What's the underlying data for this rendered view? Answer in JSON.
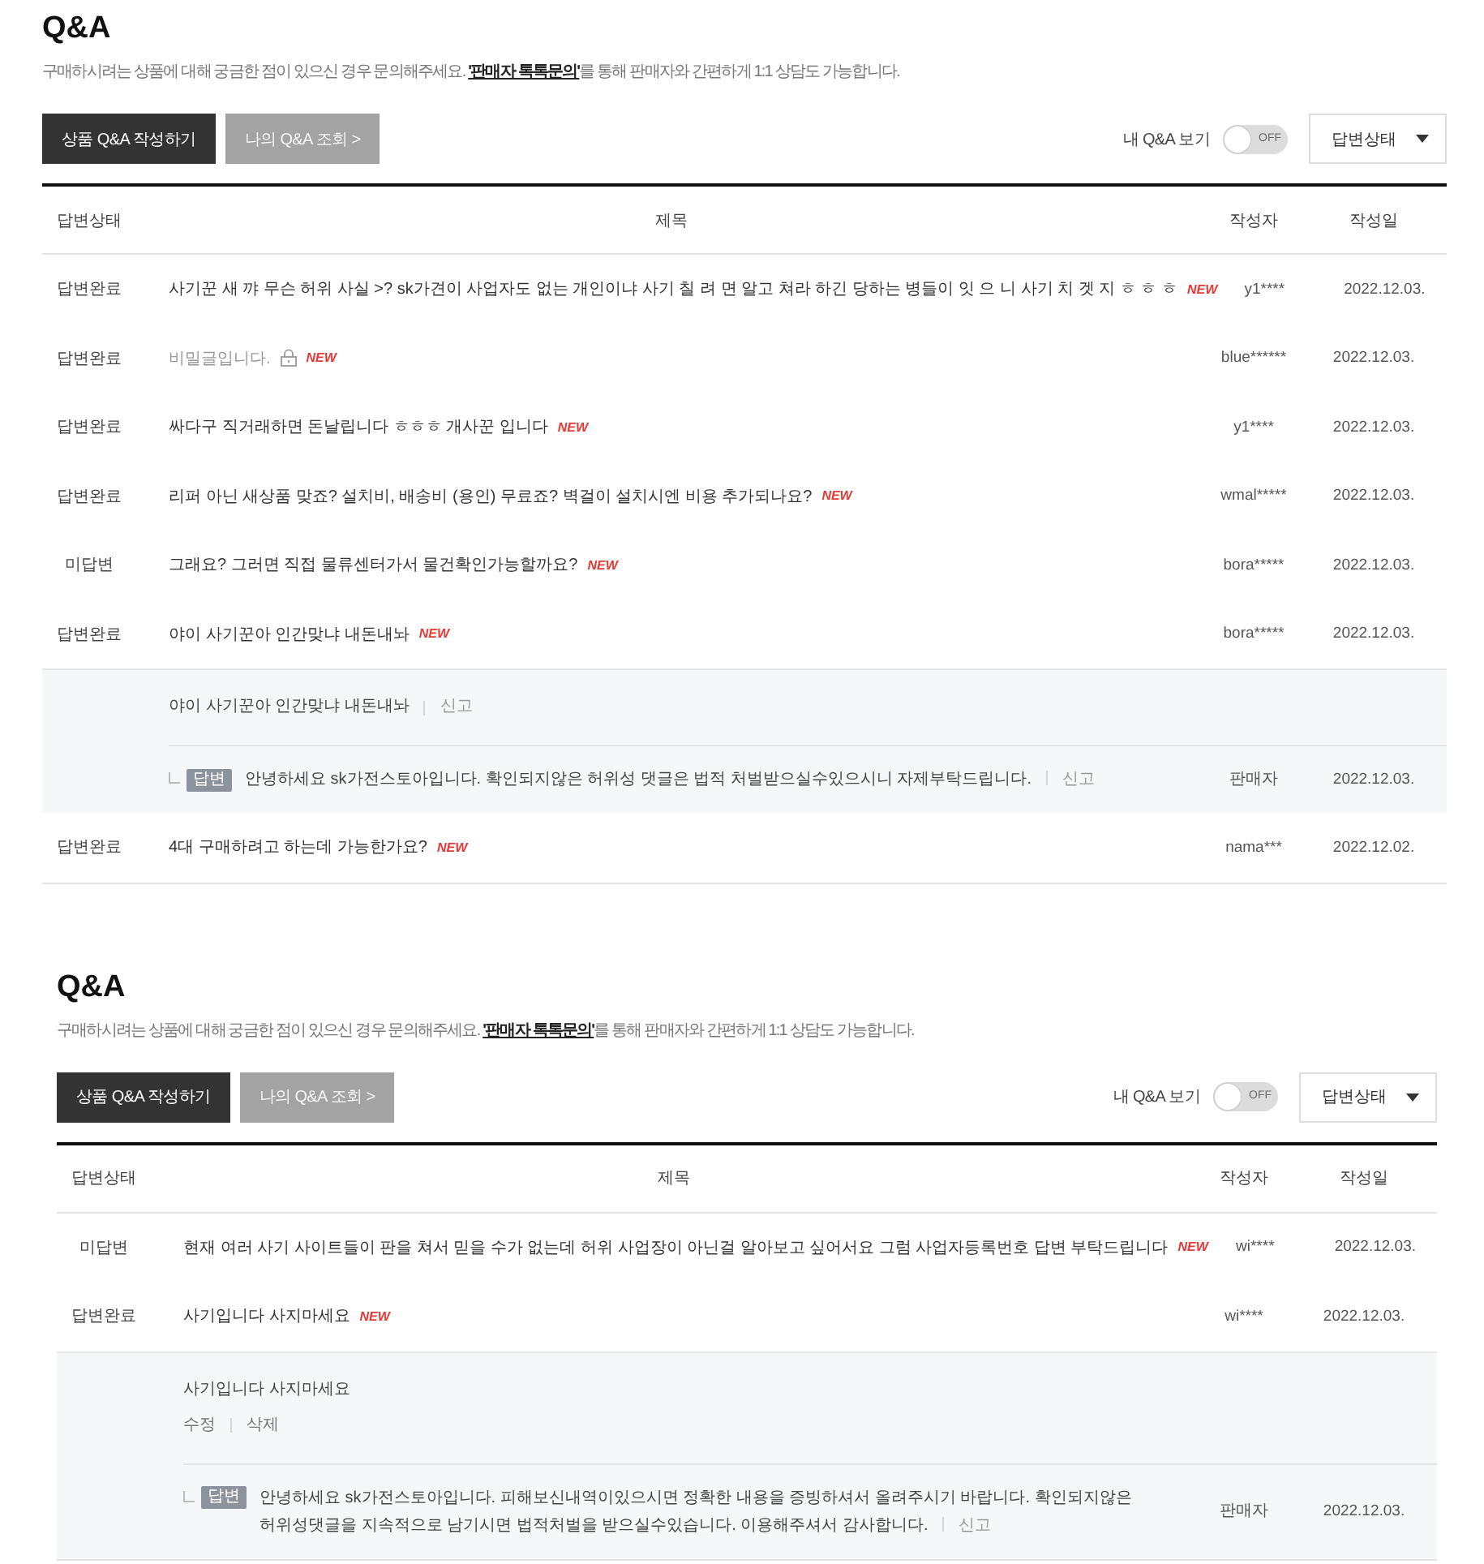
{
  "sections": [
    {
      "title": "Q&A",
      "description": {
        "before": "구매하시려는 상품에 대해 궁금한 점이 있으신 경우 문의해주세요. ",
        "link": "'판매자 톡톡문의'",
        "after": "를 통해 판매자와 간편하게 1:1 상담도 가능합니다."
      },
      "buttons": [
        {
          "label": "상품 Q&A 작성하기",
          "kind": "primary"
        },
        {
          "label": "나의 Q&A 조회 >",
          "kind": "secondary"
        }
      ],
      "my_qna_toggle": {
        "label": "내 Q&A 보기",
        "on": false,
        "state_text": "OFF"
      },
      "filter_dropdown": {
        "value": "답변상태"
      },
      "table": {
        "columns": [
          "답변상태",
          "제목",
          "작성자",
          "작성일"
        ],
        "rows": [
          {
            "status": "답변완료",
            "title": {
              "text": "사기꾼 새 꺄 무슨 허위 사실 >? sk가견이 사업자도 없는 개인이냐 사기 칠 려 면 알고 쳐라 하긴 당하는 병들이 잇 으 니 사기 치 겟 지 ㅎ ㅎ ㅎ",
              "secret": false,
              "marks": [
                {
                  "kind": "new",
                  "text": "NEW"
                }
              ]
            },
            "author": "y1****",
            "date": "2022.12.03."
          },
          {
            "status": "답변완료",
            "title": {
              "text": "비밀글입니다.",
              "secret": true,
              "marks": [
                {
                  "kind": "lock"
                },
                {
                  "kind": "new",
                  "text": "NEW"
                }
              ]
            },
            "author": "blue******",
            "date": "2022.12.03."
          },
          {
            "status": "답변완료",
            "title": {
              "text": "싸다구 직거래하면 돈날립니다 ㅎㅎㅎ 개사꾼 입니다",
              "secret": false,
              "marks": [
                {
                  "kind": "new",
                  "text": "NEW"
                }
              ]
            },
            "author": "y1****",
            "date": "2022.12.03."
          },
          {
            "status": "답변완료",
            "title": {
              "text": "리퍼 아닌 새상품 맞죠? 설치비, 배송비 (용인) 무료죠? 벽걸이 설치시엔 비용 추가되나요?",
              "secret": false,
              "marks": [
                {
                  "kind": "new",
                  "text": "NEW"
                }
              ]
            },
            "author": "wmal*****",
            "date": "2022.12.03."
          },
          {
            "status": "미답변",
            "title": {
              "text": "그래요? 그러면 직접 물류센터가서 물건확인가능할까요?",
              "secret": false,
              "marks": [
                {
                  "kind": "new",
                  "text": "NEW"
                }
              ]
            },
            "author": "bora*****",
            "date": "2022.12.03."
          },
          {
            "status": "답변완료",
            "title": {
              "text": "야이 사기꾼아 인간맞냐 내돈내놔",
              "secret": false,
              "marks": [
                {
                  "kind": "new",
                  "text": "NEW"
                }
              ]
            },
            "author": "bora*****",
            "date": "2022.12.03.",
            "detail": {
              "question": {
                "text": "야이 사기꾼아 인간맞냐 내돈내놔",
                "kind": "inline",
                "actions": [
                  "신고"
                ]
              },
              "answer": {
                "badge": "답변",
                "text": "안녕하세요 sk가전스토아입니다. 확인되지않은 허위성 댓글은 법적 처벌받으실수있으시니 자제부탁드립니다.",
                "actions": [
                  "신고"
                ],
                "author": "판매자",
                "date": "2022.12.03."
              }
            }
          },
          {
            "status": "답변완료",
            "title": {
              "text": "4대 구매하려고 하는데 가능한가요?",
              "secret": false,
              "marks": [
                {
                  "kind": "new",
                  "text": "NEW"
                }
              ]
            },
            "author": "nama***",
            "date": "2022.12.02."
          }
        ]
      }
    },
    {
      "title": "Q&A",
      "description": {
        "before": "구매하시려는 상품에 대해 궁금한 점이 있으신 경우 문의해주세요. ",
        "link": "'판매자 톡톡문의'",
        "after": "를 통해 판매자와 간편하게 1:1 상담도 가능합니다."
      },
      "buttons": [
        {
          "label": "상품 Q&A 작성하기",
          "kind": "primary"
        },
        {
          "label": "나의 Q&A 조회 >",
          "kind": "secondary"
        }
      ],
      "my_qna_toggle": {
        "label": "내 Q&A 보기",
        "on": false,
        "state_text": "OFF"
      },
      "filter_dropdown": {
        "value": "답변상태"
      },
      "table": {
        "columns": [
          "답변상태",
          "제목",
          "작성자",
          "작성일"
        ],
        "rows": [
          {
            "status": "미답변",
            "title": {
              "text": "현재 여러 사기 사이트들이 판을 쳐서 믿을 수가 없는데 허위 사업장이 아닌걸 알아보고 싶어서요 그럼 사업자등록번호 답변 부탁드립니다",
              "secret": false,
              "marks": [
                {
                  "kind": "new",
                  "text": "NEW"
                }
              ]
            },
            "author": "wi****",
            "date": "2022.12.03."
          },
          {
            "status": "답변완료",
            "title": {
              "text": "사기입니다 사지마세요",
              "secret": false,
              "marks": [
                {
                  "kind": "new",
                  "text": "NEW"
                }
              ]
            },
            "author": "wi****",
            "date": "2022.12.03.",
            "detail": {
              "question": {
                "text": "사기입니다 사지마세요",
                "kind": "stacked",
                "actions": [
                  "수정",
                  "삭제"
                ]
              },
              "answer": {
                "badge": "답변",
                "text": "안녕하세요 sk가전스토아입니다. 피해보신내역이있으시면 정확한 내용을 증빙하셔서 올려주시기 바랍니다. 확인되지않은 허위성댓글을 지속적으로 남기시면 법적처벌을 받으실수있습니다. 이용해주셔서 감사합니다.",
                "actions": [
                  "신고"
                ],
                "author": "판매자",
                "date": "2022.12.03."
              }
            }
          }
        ]
      }
    }
  ]
}
